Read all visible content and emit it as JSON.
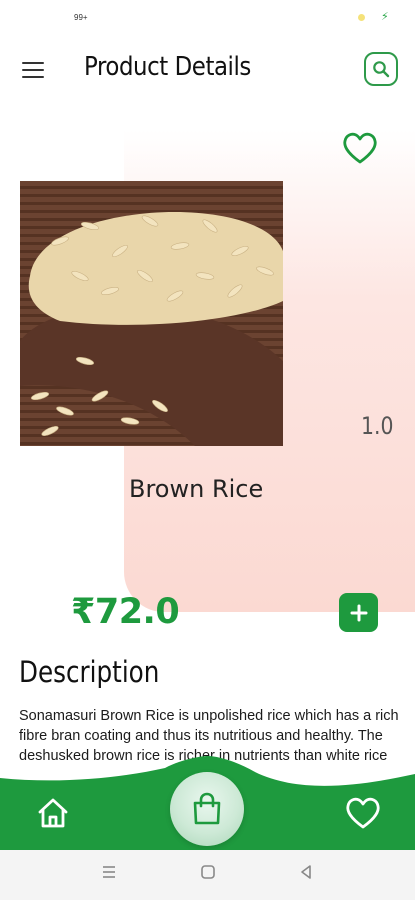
{
  "status_bar": {
    "notification_count": "99+"
  },
  "header": {
    "title": "Product Details",
    "menu_icon": "hamburger-menu-icon",
    "search_icon": "search-icon"
  },
  "product": {
    "name": "Brown Rice",
    "quantity": "1.0",
    "price": "₹72.0",
    "favorite_icon": "heart-outline-icon",
    "image_alt": "brown rice grains on wooden spoon"
  },
  "description": {
    "heading": "Description",
    "text": "Sonamasuri Brown Rice is unpolished rice which has a rich fibre bran coating and thus its nutritious and healthy. The deshusked brown rice is richer in nutrients than white rice"
  },
  "bottom_nav": {
    "items": [
      "home-icon",
      "shopping-bag-icon",
      "heart-icon"
    ]
  },
  "colors": {
    "accent_green": "#1e9a3e",
    "panel_pink": "#fbd9d2"
  }
}
